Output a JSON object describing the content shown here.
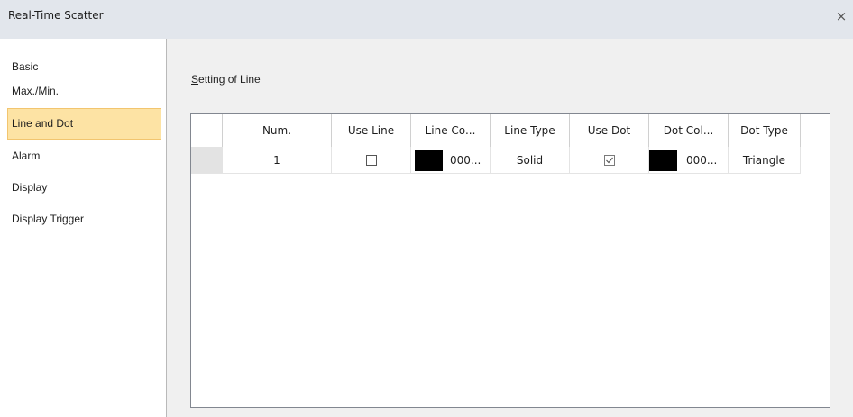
{
  "window": {
    "title": "Real-Time Scatter",
    "close_glyph": "×"
  },
  "sidebar": {
    "items": [
      {
        "label": "Basic"
      },
      {
        "label": "Max./Min."
      },
      {
        "label": "Line and Dot",
        "selected": true
      },
      {
        "label": "Alarm"
      },
      {
        "label": "Display"
      },
      {
        "label": "Display Trigger"
      }
    ]
  },
  "main": {
    "section_label_access": "S",
    "section_label_rest": "etting of Line",
    "table": {
      "headers": [
        "Num.",
        "Use Line",
        "Line Co...",
        "Line Type",
        "Use Dot",
        "Dot Col...",
        "Dot Type"
      ],
      "rows": [
        {
          "num": "1",
          "use_line": false,
          "line_color": "000...",
          "line_color_hex": "#000000",
          "line_type": "Solid",
          "use_dot": true,
          "dot_color": "000...",
          "dot_color_hex": "#000000",
          "dot_type": "Triangle"
        }
      ]
    }
  },
  "colors": {
    "titlebar": "#e2e6ec",
    "selected_bg": "#fde3a4",
    "panel_bg": "#f0f0f0"
  }
}
